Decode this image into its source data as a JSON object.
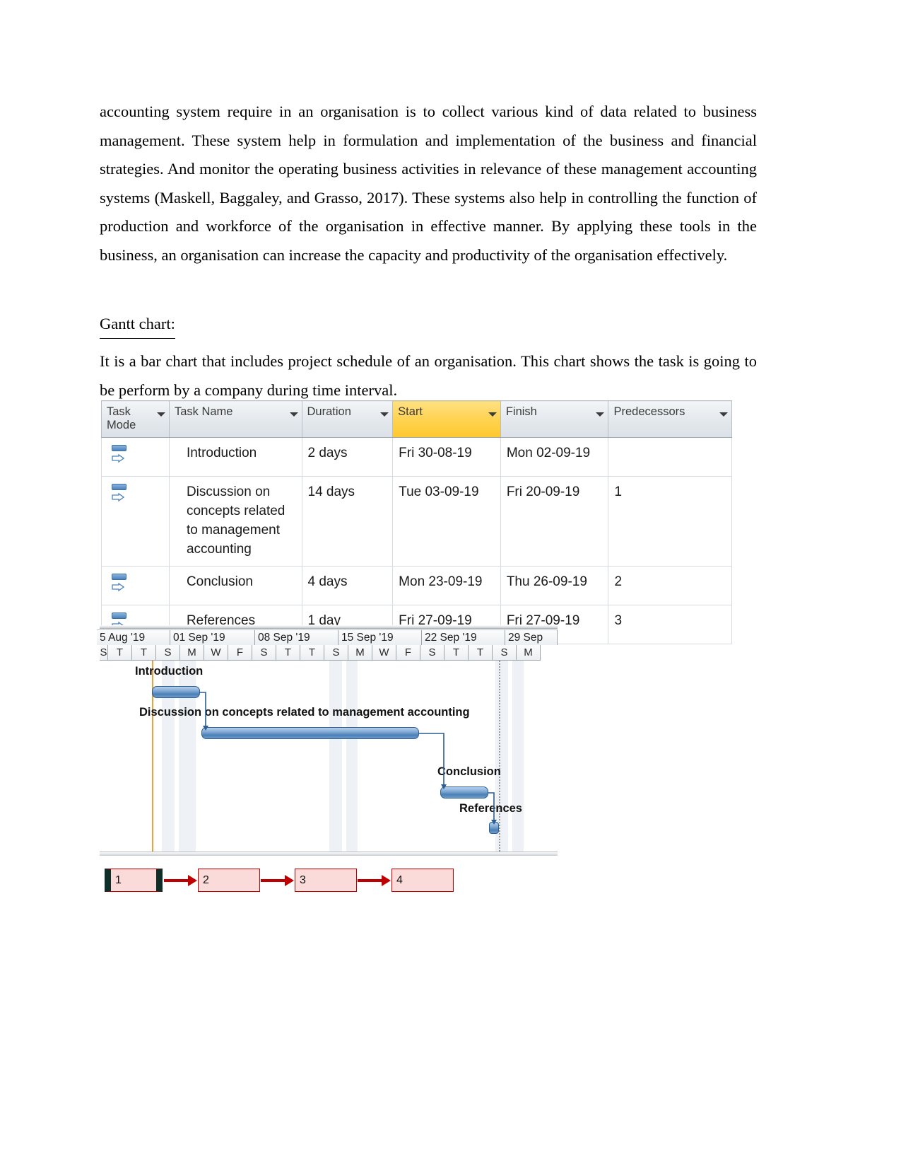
{
  "document": {
    "paragraph_1": "accounting system require in an organisation is to collect various kind of data related to business management. These system help in formulation and implementation of the business and financial strategies. And monitor the operating business activities in relevance of these management accounting systems (Maskell,  Baggaley, and Grasso, 2017). These systems also help  in controlling the function of production and  workforce of the organisation in effective manner. By applying these tools in the business,  an organisation can increase the capacity and productivity of the organisation effectively.",
    "heading": "Gantt chart:",
    "paragraph_2": "It is a bar chart that includes project schedule of an organisation. This chart shows the task is going to be perform by a company during time interval."
  },
  "task_table": {
    "columns": [
      {
        "key": "task_mode",
        "label": "Task Mode",
        "has_filter": true,
        "highlighted": false
      },
      {
        "key": "task_name",
        "label": "Task Name",
        "has_filter": true,
        "highlighted": false
      },
      {
        "key": "duration",
        "label": "Duration",
        "has_filter": true,
        "highlighted": false
      },
      {
        "key": "start",
        "label": "Start",
        "has_filter": true,
        "highlighted": true
      },
      {
        "key": "finish",
        "label": "Finish",
        "has_filter": true,
        "highlighted": false
      },
      {
        "key": "predecessors",
        "label": "Predecessors",
        "has_filter": true,
        "highlighted": false
      }
    ],
    "rows": [
      {
        "task_mode_icon": "manually-scheduled-icon",
        "task_name": "Introduction",
        "duration": "2 days",
        "start": "Fri 30-08-19",
        "finish": "Mon 02-09-19",
        "predecessors": ""
      },
      {
        "task_mode_icon": "manually-scheduled-icon",
        "task_name": "Discussion on concepts related to management accounting",
        "duration": "14 days",
        "start": "Tue 03-09-19",
        "finish": "Fri 20-09-19",
        "predecessors": "1"
      },
      {
        "task_mode_icon": "manually-scheduled-icon",
        "task_name": "Conclusion",
        "duration": "4 days",
        "start": "Mon 23-09-19",
        "finish": "Thu 26-09-19",
        "predecessors": "2"
      },
      {
        "task_mode_icon": "manually-scheduled-icon",
        "task_name": "References",
        "duration": "1 day",
        "start": "Fri 27-09-19",
        "finish": "Fri 27-09-19",
        "predecessors": "3"
      }
    ]
  },
  "chart_data": {
    "type": "bar",
    "title": "Gantt chart",
    "xlabel": "",
    "ylabel": "",
    "grid": true,
    "legend": "none",
    "timeline_weeks": [
      "5 Aug '19",
      "01 Sep '19",
      "08 Sep '19",
      "15 Sep '19",
      "22 Sep '19",
      "29 Sep"
    ],
    "timeline_days": [
      "S",
      "T",
      "T",
      "S",
      "M",
      "W",
      "F",
      "S",
      "T",
      "T",
      "S",
      "M",
      "W",
      "F",
      "S",
      "T",
      "T",
      "S",
      "M"
    ],
    "categories": [
      "Introduction",
      "Discussion on concepts related to management accounting",
      "Conclusion",
      "References"
    ],
    "bars": [
      {
        "label": "Introduction",
        "start": "Fri 30-08-19",
        "finish": "Mon 02-09-19",
        "duration_days": 2,
        "predecessor": ""
      },
      {
        "label": "Discussion on concepts related to management accounting",
        "start": "Tue 03-09-19",
        "finish": "Fri 20-09-19",
        "duration_days": 14,
        "predecessor": "1"
      },
      {
        "label": "Conclusion",
        "start": "Mon 23-09-19",
        "finish": "Thu 26-09-19",
        "duration_days": 4,
        "predecessor": "2"
      },
      {
        "label": "References",
        "start": "Fri 27-09-19",
        "finish": "Fri 27-09-19",
        "duration_days": 1,
        "predecessor": "3"
      }
    ],
    "values": [
      2,
      14,
      4,
      1
    ]
  },
  "network_diagram": {
    "nodes": [
      {
        "id": "1",
        "label": "1"
      },
      {
        "id": "2",
        "label": "2"
      },
      {
        "id": "3",
        "label": "3"
      },
      {
        "id": "4",
        "label": "4"
      }
    ],
    "links": [
      "1->2",
      "2->3",
      "3->4"
    ]
  },
  "colors": {
    "start_column_highlight": "#ffd24d",
    "gantt_bar": "#4b7fb5",
    "network_box_fill": "#fbdada",
    "network_box_border": "#c00000",
    "today_line": "#e8a33d"
  }
}
